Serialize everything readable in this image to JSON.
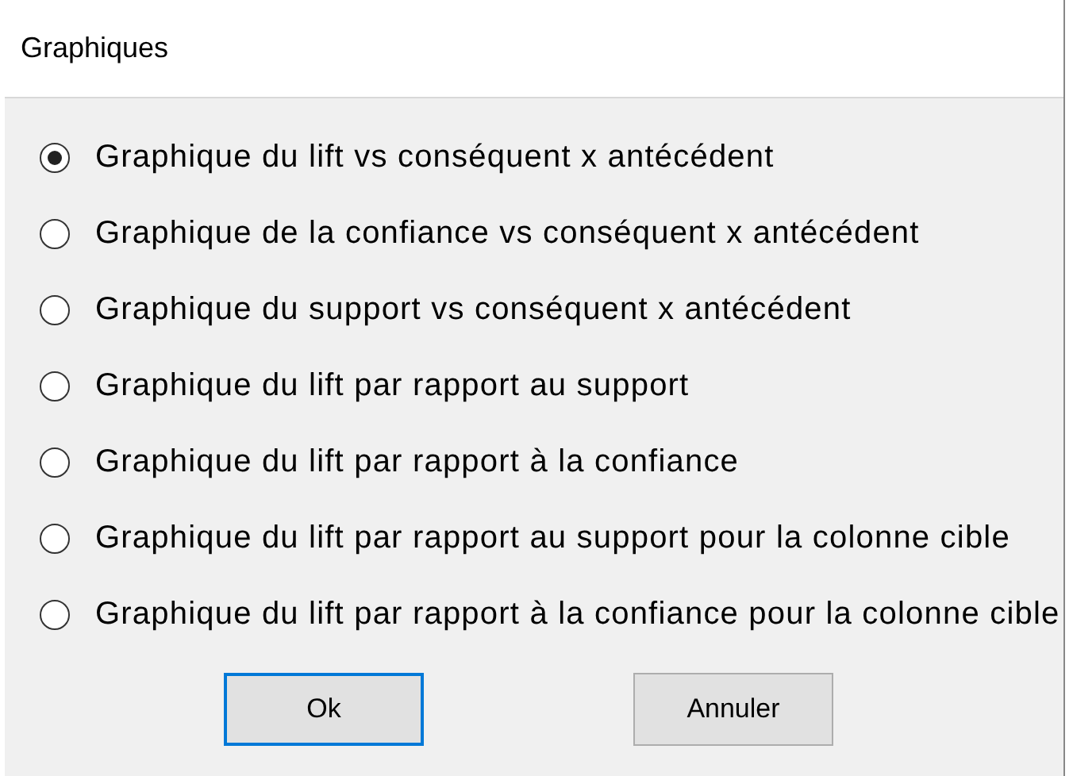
{
  "window": {
    "title": "Graphiques"
  },
  "options": [
    {
      "label": "Graphique du lift vs conséquent x antécédent",
      "selected": true
    },
    {
      "label": "Graphique de la confiance vs conséquent x antécédent",
      "selected": false
    },
    {
      "label": "Graphique du support vs conséquent x antécédent",
      "selected": false
    },
    {
      "label": "Graphique du lift par rapport au support",
      "selected": false
    },
    {
      "label": "Graphique du lift par rapport à la confiance",
      "selected": false
    },
    {
      "label": "Graphique du lift par rapport au support pour la colonne cible",
      "selected": false
    },
    {
      "label": "Graphique du lift par rapport à la confiance pour la colonne cible",
      "selected": false
    }
  ],
  "buttons": [
    {
      "label": "Ok",
      "default": true
    },
    {
      "label": "Annuler",
      "default": false
    }
  ]
}
